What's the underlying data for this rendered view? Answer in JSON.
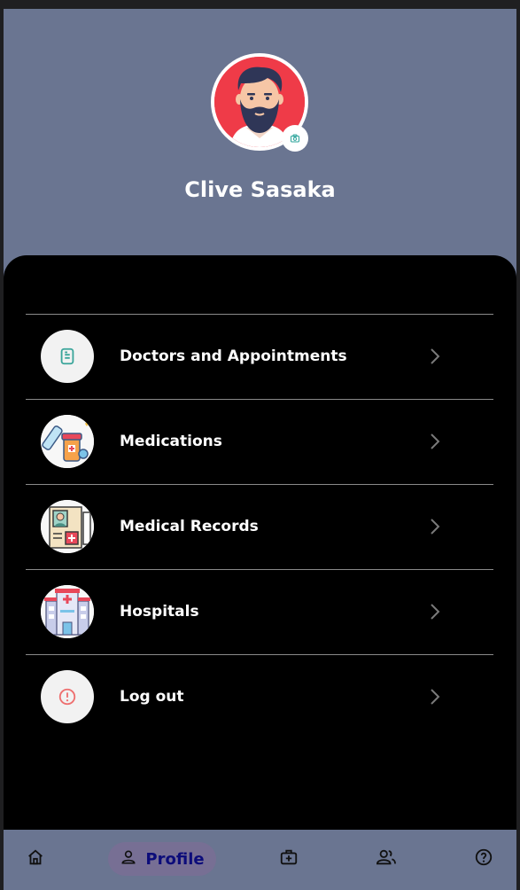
{
  "profile": {
    "name": "Clive Sasaka",
    "avatar": "avatar-bearded-man",
    "camera_icon": "camera-icon"
  },
  "menu": {
    "items": [
      {
        "label": "Doctors and Appointments",
        "icon": "document-icon"
      },
      {
        "label": "Medications",
        "icon": "medication-icon"
      },
      {
        "label": "Medical Records",
        "icon": "medical-records-icon"
      },
      {
        "label": "Hospitals",
        "icon": "hospital-icon"
      },
      {
        "label": "Log out",
        "icon": "alert-icon"
      }
    ],
    "chevron_icon": "chevron-right-icon"
  },
  "bottom_nav": {
    "items": [
      {
        "icon": "home-icon",
        "label": ""
      },
      {
        "icon": "person-icon",
        "label": "Profile",
        "active": true
      },
      {
        "icon": "first-aid-icon",
        "label": ""
      },
      {
        "icon": "group-icon",
        "label": ""
      },
      {
        "icon": "help-icon",
        "label": ""
      }
    ]
  },
  "colors": {
    "header_bg": "#6a7591",
    "sheet_bg": "#000000",
    "avatar_bg": "#ef3b48",
    "active_nav_bg": "#776f94",
    "active_nav_text": "#0c0c7a"
  }
}
